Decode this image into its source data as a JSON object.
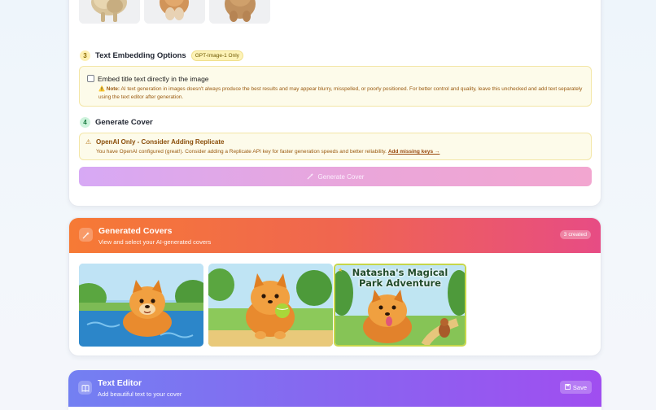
{
  "step3": {
    "number": "3",
    "title": "Text Embedding Options",
    "chip": "GPT-Image-1 Only",
    "checkbox_label": "Embed title text directly in the image",
    "note_prefix": "⚠️ Note:",
    "note_text": "AI text generation in images doesn't always produce the best results and may appear blurry, misspelled, or poorly positioned. For better control and quality, leave this unchecked and add text separately using the text editor after generation.",
    "checked": false
  },
  "step4": {
    "number": "4",
    "title": "Generate Cover",
    "warning_icon": "⚠",
    "warning_title": "OpenAI Only - Consider Adding Replicate",
    "warning_text": "You have OpenAI configured (great!). Consider adding a Replicate API key for faster generation speeds and better reliability.",
    "warning_link": "Add missing keys →",
    "button_label": "Generate Cover"
  },
  "covers": {
    "title": "Generated Covers",
    "subtitle": "View and select your AI-generated covers",
    "count_badge": "3 created",
    "cover_text_line1": "Natasha's Magical",
    "cover_text_line2": "Park Adventure",
    "selected_index": 2
  },
  "editor": {
    "title": "Text Editor",
    "subtitle": "Add beautiful text to your cover",
    "save_label": "Save"
  },
  "colors": {
    "covers_gradient_start": "#f67a35",
    "covers_gradient_end": "#e74c84",
    "editor_gradient_start": "#7380f2",
    "editor_gradient_end": "#a04ef0",
    "generate_button": "#e3a8e6"
  },
  "icons": {
    "generate": "magic-wand-icon",
    "covers_header": "magic-wand-icon",
    "editor_header": "book-icon",
    "save": "save-icon",
    "warning": "warning-icon"
  }
}
